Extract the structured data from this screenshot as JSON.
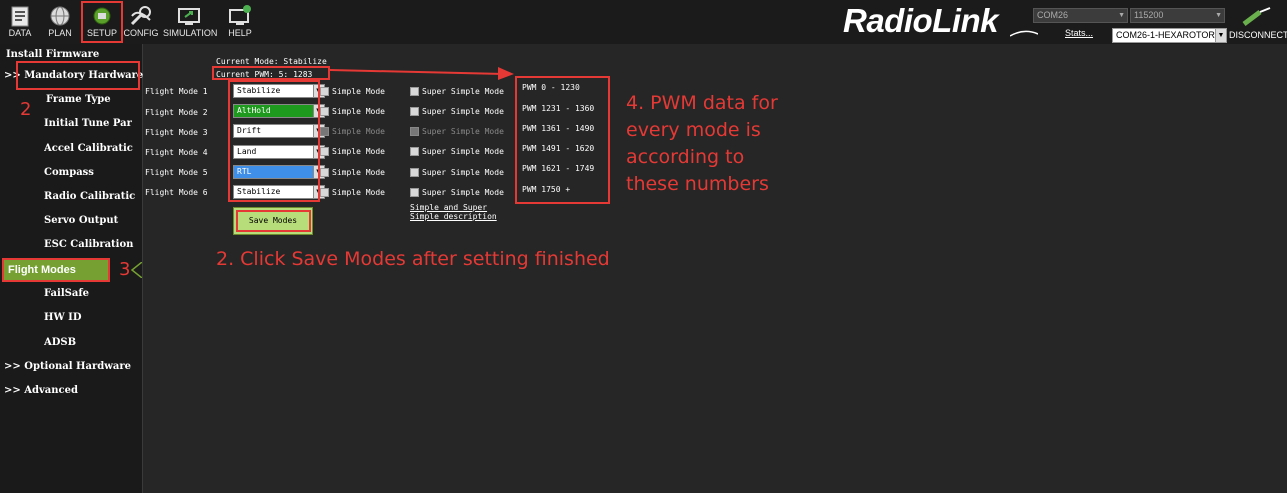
{
  "toolbar": {
    "buttons": [
      {
        "label": "DATA",
        "icon": "data-icon"
      },
      {
        "label": "PLAN",
        "icon": "globe-icon"
      },
      {
        "label": "SETUP",
        "icon": "setup-icon"
      },
      {
        "label": "CONFIG",
        "icon": "config-icon"
      },
      {
        "label": "SIMULATION",
        "icon": "simulation-icon"
      },
      {
        "label": "HELP",
        "icon": "help-icon"
      }
    ],
    "selected": "SETUP",
    "logo": "RadioLink",
    "port": "COM26",
    "baud": "115200",
    "stats_link": "Stats...",
    "connection": "COM26-1-HEXAROTOR",
    "disconnect_label": "DISCONNECT"
  },
  "sidebar": {
    "items": [
      {
        "label": "Install Firmware"
      },
      {
        "label": ">> Mandatory Hardware"
      },
      {
        "label": "Frame Type"
      },
      {
        "label": "Initial Tune Par"
      },
      {
        "label": "Accel Calibratic"
      },
      {
        "label": "Compass"
      },
      {
        "label": "Radio Calibratic"
      },
      {
        "label": "Servo Output"
      },
      {
        "label": "ESC Calibration"
      },
      {
        "label": "Flight Modes"
      },
      {
        "label": "FailSafe"
      },
      {
        "label": "HW ID"
      },
      {
        "label": "ADSB"
      },
      {
        "label": ">> Optional Hardware"
      },
      {
        "label": ">> Advanced"
      }
    ],
    "selected": "Flight Modes"
  },
  "flight_modes": {
    "current_mode": "Current Mode: Stabilize",
    "current_pwm": "Current PWM:  5: 1283",
    "modes": [
      {
        "label": "Flight Mode 1",
        "value": "Stabilize",
        "simple": "Simple Mode",
        "super_simple": "Super Simple Mode",
        "pwm": "PWM 0 - 1230"
      },
      {
        "label": "Flight Mode 2",
        "value": "AltHold",
        "simple": "Simple Mode",
        "super_simple": "Super Simple Mode",
        "pwm": "PWM 1231 - 1360"
      },
      {
        "label": "Flight Mode 3",
        "value": "Drift",
        "simple": "Simple Mode",
        "super_simple": "Super Simple Mode",
        "pwm": "PWM 1361 - 1490"
      },
      {
        "label": "Flight Mode 4",
        "value": "Land",
        "simple": "Simple Mode",
        "super_simple": "Super Simple Mode",
        "pwm": "PWM 1491 - 1620"
      },
      {
        "label": "Flight Mode 5",
        "value": "RTL",
        "simple": "Simple Mode",
        "super_simple": "Super Simple Mode",
        "pwm": "PWM 1621 - 1749"
      },
      {
        "label": "Flight Mode 6",
        "value": "Stabilize",
        "simple": "Simple Mode",
        "super_simple": "Super Simple Mode",
        "pwm": "PWM 1750 +"
      }
    ],
    "save_label": "Save Modes",
    "simple_desc_line1": "Simple and Super",
    "simple_desc_line2": "Simple description"
  },
  "annotations": {
    "step2_num": "2",
    "step3_num": "3",
    "save_hint": "2. Click Save Modes after setting finished",
    "pwm_hint_1": "4. PWM data for",
    "pwm_hint_2": "every mode is",
    "pwm_hint_3": "according to",
    "pwm_hint_4": "these numbers"
  },
  "colors": {
    "accent_green": "#76a132",
    "annotation_red": "#e53935",
    "althold_bg": "#1e9a1e",
    "rtl_bg": "#3f8fe8"
  }
}
